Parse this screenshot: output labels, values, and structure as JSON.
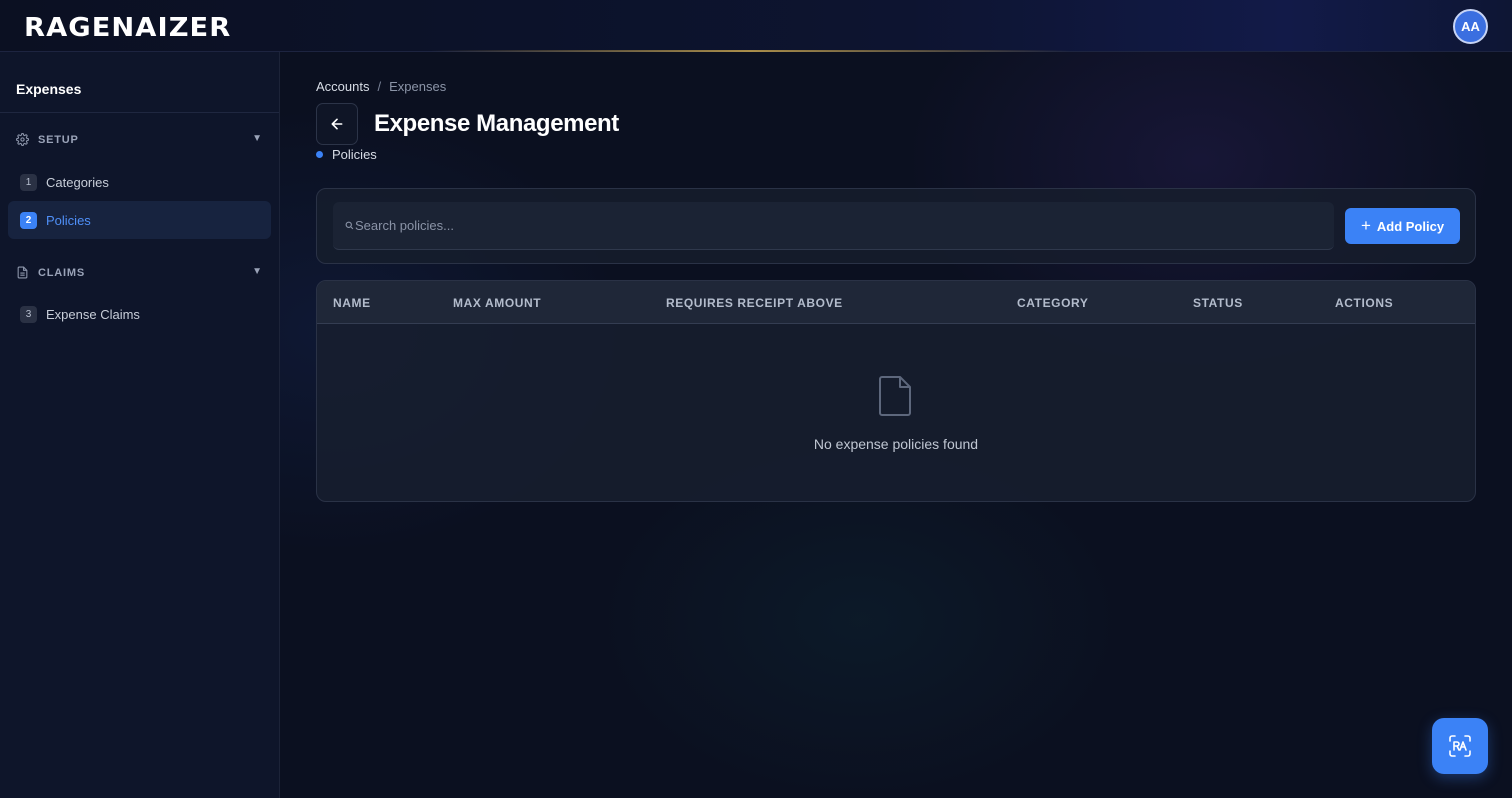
{
  "header": {
    "logo_text": "RAGENAIZER",
    "avatar_initials": "AA"
  },
  "sidebar": {
    "title": "Expenses",
    "sections": [
      {
        "label": "SETUP",
        "icon": "gear-icon",
        "items": [
          {
            "number": "1",
            "label": "Categories",
            "active": false
          },
          {
            "number": "2",
            "label": "Policies",
            "active": true
          }
        ]
      },
      {
        "label": "CLAIMS",
        "icon": "document-icon",
        "items": [
          {
            "number": "3",
            "label": "Expense Claims",
            "active": false
          }
        ]
      }
    ]
  },
  "breadcrumb": {
    "items": [
      "Accounts",
      "Expenses"
    ],
    "separator": "/"
  },
  "page": {
    "title": "Expense Management",
    "subnav_label": "Policies"
  },
  "toolbar": {
    "search_placeholder": "Search policies...",
    "add_label": "Add Policy"
  },
  "table": {
    "columns": [
      "NAME",
      "MAX AMOUNT",
      "REQUIRES RECEIPT ABOVE",
      "CATEGORY",
      "STATUS",
      "ACTIONS"
    ],
    "rows": [],
    "empty_text": "No expense policies found"
  },
  "colors": {
    "accent": "#3b82f6",
    "background": "#0b1020",
    "sidebar": "#0e152a"
  }
}
